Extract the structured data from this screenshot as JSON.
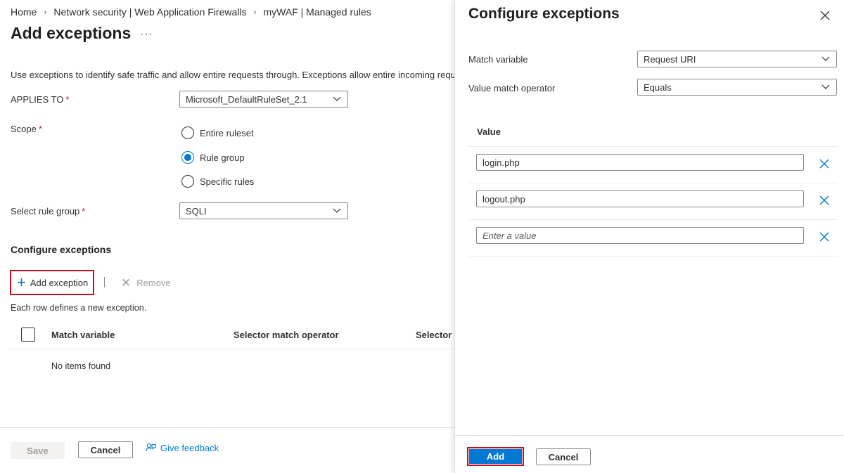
{
  "breadcrumb": [
    "Home",
    "Network security | Web Application Firewalls",
    "myWAF | Managed rules"
  ],
  "page": {
    "title": "Add exceptions",
    "more_icon": "more-horizontal-icon",
    "intro": "Use exceptions to identify safe traffic and allow entire requests through. Exceptions allow entire incoming requests"
  },
  "form": {
    "applies_to_label": "APPLIES TO",
    "applies_to_value": "Microsoft_DefaultRuleSet_2.1",
    "scope_label": "Scope",
    "scope_options": [
      "Entire ruleset",
      "Rule group",
      "Specific rules"
    ],
    "scope_selected": "Rule group",
    "rule_group_label": "Select rule group",
    "rule_group_value": "SQLI",
    "required_marker": "*"
  },
  "exceptions_section": {
    "title": "Configure exceptions",
    "add_label": "Add exception",
    "remove_label": "Remove",
    "hint": "Each row defines a new exception.",
    "columns": [
      "Match variable",
      "Selector match operator",
      "Selector"
    ],
    "empty_text": "No items found"
  },
  "footer": {
    "save": "Save",
    "cancel": "Cancel",
    "feedback": "Give feedback"
  },
  "panel": {
    "title": "Configure exceptions",
    "match_variable_label": "Match variable",
    "match_variable_value": "Request URI",
    "operator_label": "Value match operator",
    "operator_value": "Equals",
    "value_header": "Value",
    "values": [
      "login.php",
      "logout.php"
    ],
    "value_placeholder": "Enter a value",
    "add": "Add",
    "cancel": "Cancel"
  },
  "colors": {
    "accent": "#0078d4",
    "highlight_border": "#c50f1f",
    "required": "#a4262c"
  }
}
